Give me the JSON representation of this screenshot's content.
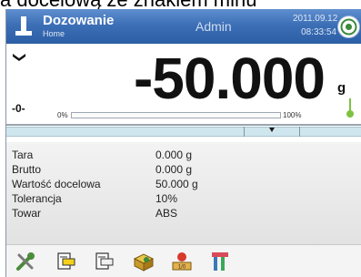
{
  "caption": "a docelową ze znakiem minu",
  "header": {
    "title": "Dozowanie",
    "subtitle": "Home",
    "user": "Admin",
    "date": "2011.09.12",
    "time": "08:33:54"
  },
  "display": {
    "weight": "-50.000",
    "unit": "g",
    "zero": "-0-",
    "range_min": "0%",
    "range_max": "100%",
    "bar_fill_percent": 0
  },
  "info": [
    {
      "label": "Tara",
      "value": "0.000 g"
    },
    {
      "label": "Brutto",
      "value": "0.000 g"
    },
    {
      "label": "Wartość docelowa",
      "value": "50.000 g"
    },
    {
      "label": "Tolerancja",
      "value": "10%"
    },
    {
      "label": "Towar",
      "value": "ABS"
    }
  ],
  "toolbar": [
    {
      "icon": "tools-icon"
    },
    {
      "icon": "document-yellow-icon"
    },
    {
      "icon": "document-white-icon"
    },
    {
      "icon": "product-box-icon"
    },
    {
      "icon": "target-dosing-icon"
    },
    {
      "icon": "tare-memory-icon"
    }
  ],
  "colors": {
    "header": "#3c6fb6",
    "tolerance_bar": "#cfe6ef",
    "stable_marker": "#7dc242"
  }
}
